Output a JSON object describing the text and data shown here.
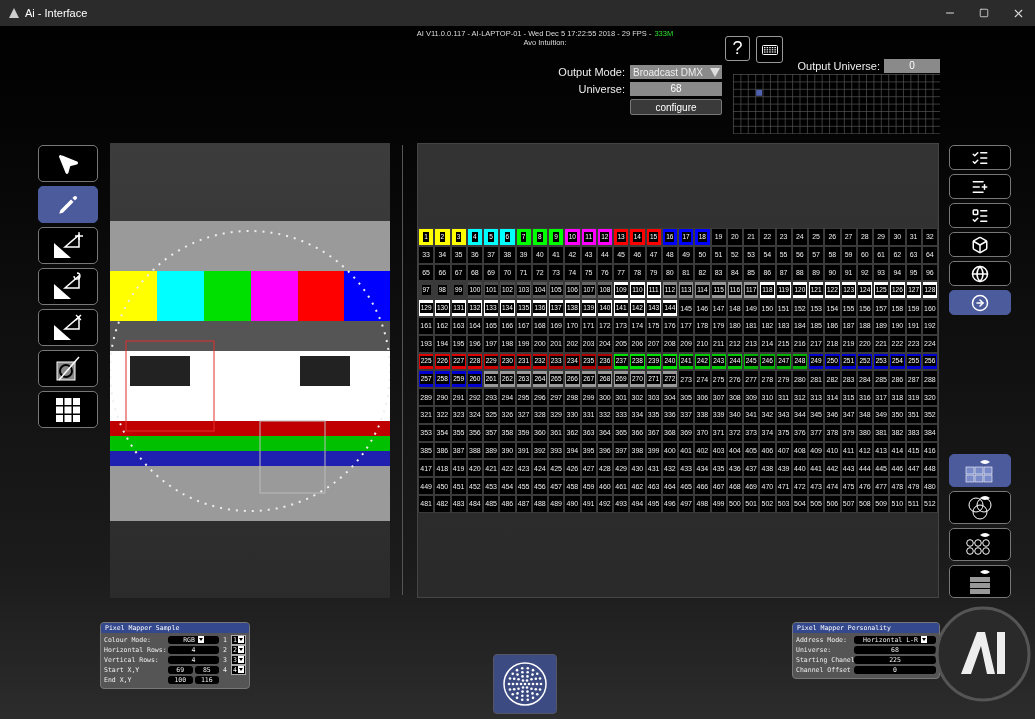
{
  "window": {
    "title": "Ai - Interface"
  },
  "info": {
    "text": "AI V11.0.0.117 - AI-LAPTOP-01 - Wed Dec 5 17:22:55 2018 - 29 FPS -",
    "memory": "333M",
    "subtitle": "Avo Intuition:"
  },
  "help_button": {
    "label": "?"
  },
  "output": {
    "mode_label": "Output Mode:",
    "mode_value": "Broadcast DMX",
    "universe_label": "Universe:",
    "universe_value": "68",
    "configure": "configure",
    "output_universe_label": "Output Universe:",
    "output_universe_value": "0"
  },
  "left_tools": [
    {
      "selected": false
    },
    {
      "selected": true
    },
    {
      "selected": false
    },
    {
      "selected": false
    },
    {
      "selected": false
    },
    {
      "selected": false
    },
    {
      "selected": false
    }
  ],
  "right_tools": [
    {
      "selected": false
    },
    {
      "selected": false
    },
    {
      "selected": false
    },
    {
      "selected": false
    },
    {
      "selected": false
    },
    {
      "selected": true
    }
  ],
  "view_tools": [
    {
      "selected": true
    },
    {
      "selected": false
    },
    {
      "selected": false
    },
    {
      "selected": false
    }
  ],
  "grid": {
    "rows": [
      {
        "cells": [
          {
            "label": "1",
            "color": "#ffff00"
          },
          {
            "label": "2",
            "color": "#ffff00"
          },
          {
            "label": "3",
            "color": "#ffff00"
          },
          {
            "label": "4",
            "color": "#00ffff"
          },
          {
            "label": "5",
            "color": "#00ffff"
          },
          {
            "label": "6",
            "color": "#00ffff"
          },
          {
            "label": "7",
            "color": "#00ff00"
          },
          {
            "label": "8",
            "color": "#00ff00"
          },
          {
            "label": "9",
            "color": "#00ff00"
          },
          {
            "label": "10",
            "color": "#ff00ff"
          },
          {
            "label": "11",
            "color": "#ff00ff"
          },
          {
            "label": "12",
            "color": "#ff00ff"
          },
          {
            "label": "13",
            "color": "#ff0000"
          },
          {
            "label": "14",
            "color": "#ff0000"
          },
          {
            "label": "15",
            "color": "#ff0000"
          },
          {
            "label": "16",
            "color": "#0000ff"
          },
          {
            "label": "17",
            "color": "#0000ff"
          },
          {
            "label": "18",
            "color": "#0000ff"
          },
          "19",
          "20",
          "21",
          "22",
          "23",
          "24",
          "25",
          "26",
          "27",
          "28",
          "29",
          "30",
          "31",
          "32"
        ]
      },
      {
        "cells": [
          "33",
          "34",
          "35",
          "36",
          "37",
          "38",
          "39",
          "40",
          "41",
          "42",
          "43",
          "44",
          "45",
          "46",
          "47",
          "48",
          "49",
          "50",
          "51",
          "52",
          "53",
          "54",
          "55",
          "56",
          "57",
          "58",
          "59",
          "60",
          "61",
          "62",
          "63",
          "64"
        ]
      },
      {
        "cells": [
          "65",
          "66",
          "67",
          "68",
          "69",
          "70",
          "71",
          "72",
          "73",
          "74",
          "75",
          "76",
          "77",
          "78",
          "79",
          "80",
          "81",
          "82",
          "83",
          "84",
          "85",
          "86",
          "87",
          "88",
          "89",
          "90",
          "91",
          "92",
          "93",
          "94",
          "95",
          "96"
        ]
      },
      {
        "cells": [
          {
            "label": "97",
            "color": "#3a3a3a"
          },
          {
            "label": "98",
            "color": "#3a3a3a"
          },
          {
            "label": "99",
            "color": "#3a3a3a"
          },
          {
            "label": "100",
            "color": "#4a4a4a"
          },
          {
            "label": "101",
            "color": "#4a4a4a"
          },
          {
            "label": "102",
            "color": "#4a4a4a"
          },
          {
            "label": "103",
            "color": "#565656"
          },
          {
            "label": "104",
            "color": "#565656"
          },
          {
            "label": "105",
            "color": "#565656"
          },
          {
            "label": "106",
            "color": "#666666"
          },
          {
            "label": "107",
            "color": "#666666"
          },
          {
            "label": "108",
            "color": "#666666"
          },
          {
            "label": "109",
            "color": "#ffffff"
          },
          {
            "label": "110",
            "color": "#ffffff"
          },
          {
            "label": "111",
            "color": "#ffffff"
          },
          {
            "label": "112",
            "color": "#888888"
          },
          {
            "label": "113",
            "color": "#888888"
          },
          {
            "label": "114",
            "color": "#888888"
          },
          {
            "label": "115",
            "color": "#999999"
          },
          {
            "label": "116",
            "color": "#999999"
          },
          {
            "label": "117",
            "color": "#999999"
          },
          {
            "label": "118",
            "color": "#ffffff"
          },
          {
            "label": "119",
            "color": "#ffffff"
          },
          {
            "label": "120",
            "color": "#ffffff"
          },
          {
            "label": "121",
            "color": "#ffffff"
          },
          {
            "label": "122",
            "color": "#ffffff"
          },
          {
            "label": "123",
            "color": "#ffffff"
          },
          {
            "label": "124",
            "color": "#ffffff"
          },
          {
            "label": "125",
            "color": "#ffffff"
          },
          {
            "label": "126",
            "color": "#ffffff"
          },
          {
            "label": "127",
            "color": "#ffffff"
          },
          {
            "label": "128",
            "color": "#ffffff"
          }
        ]
      },
      {
        "cells": [
          {
            "label": "129",
            "color": "#ffffff"
          },
          {
            "label": "130",
            "color": "#ffffff"
          },
          {
            "label": "131",
            "color": "#ffffff"
          },
          {
            "label": "132",
            "color": "#ffffff"
          },
          {
            "label": "133",
            "color": "#ffffff"
          },
          {
            "label": "134",
            "color": "#ffffff"
          },
          {
            "label": "135",
            "color": "#ffffff"
          },
          {
            "label": "136",
            "color": "#ffffff"
          },
          {
            "label": "137",
            "color": "#ffffff"
          },
          {
            "label": "138",
            "color": "#ffffff"
          },
          {
            "label": "139",
            "color": "#ffffff"
          },
          {
            "label": "140",
            "color": "#ffffff"
          },
          {
            "label": "141",
            "color": "#ffffff"
          },
          {
            "label": "142",
            "color": "#ffffff"
          },
          {
            "label": "143",
            "color": "#ffffff"
          },
          {
            "label": "144",
            "color": "#ffffff"
          },
          "145",
          "146",
          "147",
          "148",
          "149",
          "150",
          "151",
          "152",
          "153",
          "154",
          "155",
          "156",
          "157",
          "158",
          "159",
          "160"
        ]
      },
      {
        "cells": [
          "161",
          "162",
          "163",
          "164",
          "165",
          "166",
          "167",
          "168",
          "169",
          "170",
          "171",
          "172",
          "173",
          "174",
          "175",
          "176",
          "177",
          "178",
          "179",
          "180",
          "181",
          "182",
          "183",
          "184",
          "185",
          "186",
          "187",
          "188",
          "189",
          "190",
          "191",
          "192"
        ]
      },
      {
        "cells": [
          "193",
          "194",
          "195",
          "196",
          "197",
          "198",
          "199",
          "200",
          "201",
          "202",
          "203",
          "204",
          "205",
          "206",
          "207",
          "208",
          "209",
          "210",
          "211",
          "212",
          "213",
          "214",
          "215",
          "216",
          "217",
          "218",
          "219",
          "220",
          "221",
          "222",
          "223",
          "224"
        ]
      },
      {
        "cells": [
          {
            "label": "225",
            "color": "#e00000"
          },
          {
            "label": "226",
            "color": "#e00000"
          },
          {
            "label": "227",
            "color": "#e00000"
          },
          {
            "label": "228",
            "color": "#e00000"
          },
          {
            "label": "229",
            "color": "#c80000"
          },
          {
            "label": "230",
            "color": "#c80000"
          },
          {
            "label": "231",
            "color": "#c80000"
          },
          {
            "label": "232",
            "color": "#c80000"
          },
          {
            "label": "233",
            "color": "#b00000"
          },
          {
            "label": "234",
            "color": "#b00000"
          },
          {
            "label": "235",
            "color": "#b00000"
          },
          {
            "label": "236",
            "color": "#b00000"
          },
          {
            "label": "237",
            "color": "#00e000"
          },
          {
            "label": "238",
            "color": "#00e000"
          },
          {
            "label": "239",
            "color": "#00e000"
          },
          {
            "label": "240",
            "color": "#00e000"
          },
          {
            "label": "241",
            "color": "#00c800"
          },
          {
            "label": "242",
            "color": "#00c800"
          },
          {
            "label": "243",
            "color": "#00c800"
          },
          {
            "label": "244",
            "color": "#00c800"
          },
          {
            "label": "245",
            "color": "#00b000"
          },
          {
            "label": "246",
            "color": "#00b000"
          },
          {
            "label": "247",
            "color": "#00b000"
          },
          {
            "label": "248",
            "color": "#00b000"
          },
          {
            "label": "249",
            "color": "#0000d0"
          },
          {
            "label": "250",
            "color": "#0000d0"
          },
          {
            "label": "251",
            "color": "#0000d0"
          },
          {
            "label": "252",
            "color": "#0000d0"
          },
          {
            "label": "253",
            "color": "#0000d0"
          },
          {
            "label": "254",
            "color": "#0000d0"
          },
          {
            "label": "255",
            "color": "#0000d0"
          },
          {
            "label": "256",
            "color": "#0000d0"
          }
        ]
      },
      {
        "cells": [
          {
            "label": "257",
            "color": "#0000d0"
          },
          {
            "label": "258",
            "color": "#0000d0"
          },
          {
            "label": "259",
            "color": "#0000d0"
          },
          {
            "label": "260",
            "color": "#0000d0"
          },
          {
            "label": "261",
            "color": "#999999"
          },
          {
            "label": "262",
            "color": "#999999"
          },
          {
            "label": "263",
            "color": "#999999"
          },
          {
            "label": "264",
            "color": "#999999"
          },
          {
            "label": "265",
            "color": "#999999"
          },
          {
            "label": "266",
            "color": "#999999"
          },
          {
            "label": "267",
            "color": "#999999"
          },
          {
            "label": "268",
            "color": "#999999"
          },
          {
            "label": "269",
            "color": "#999999"
          },
          {
            "label": "270",
            "color": "#999999"
          },
          {
            "label": "271",
            "color": "#999999"
          },
          {
            "label": "272",
            "color": "#999999"
          },
          "273",
          "274",
          "275",
          "276",
          "277",
          "278",
          "279",
          "280",
          "281",
          "282",
          "283",
          "284",
          "285",
          "286",
          "287",
          "288"
        ]
      },
      {
        "cells": [
          "289",
          "290",
          "291",
          "292",
          "293",
          "294",
          "295",
          "296",
          "297",
          "298",
          "299",
          "300",
          "301",
          "302",
          "303",
          "304",
          "305",
          "306",
          "307",
          "308",
          "309",
          "310",
          "311",
          "312",
          "313",
          "314",
          "315",
          "316",
          "317",
          "318",
          "319",
          "320"
        ]
      },
      {
        "cells": [
          "321",
          "322",
          "323",
          "324",
          "325",
          "326",
          "327",
          "328",
          "329",
          "330",
          "331",
          "332",
          "333",
          "334",
          "335",
          "336",
          "337",
          "338",
          "339",
          "340",
          "341",
          "342",
          "343",
          "344",
          "345",
          "346",
          "347",
          "348",
          "349",
          "350",
          "351",
          "352"
        ]
      },
      {
        "cells": [
          "353",
          "354",
          "355",
          "356",
          "357",
          "358",
          "359",
          "360",
          "361",
          "362",
          "363",
          "364",
          "365",
          "366",
          "367",
          "368",
          "369",
          "370",
          "371",
          "372",
          "373",
          "374",
          "375",
          "376",
          "377",
          "378",
          "379",
          "380",
          "381",
          "382",
          "383",
          "384"
        ]
      },
      {
        "cells": [
          "385",
          "386",
          "387",
          "388",
          "389",
          "390",
          "391",
          "392",
          "393",
          "394",
          "395",
          "396",
          "397",
          "398",
          "399",
          "400",
          "401",
          "402",
          "403",
          "404",
          "405",
          "406",
          "407",
          "408",
          "409",
          "410",
          "411",
          "412",
          "413",
          "414",
          "415",
          "416"
        ]
      },
      {
        "cells": [
          "417",
          "418",
          "419",
          "420",
          "421",
          "422",
          "423",
          "424",
          "425",
          "426",
          "427",
          "428",
          "429",
          "430",
          "431",
          "432",
          "433",
          "434",
          "435",
          "436",
          "437",
          "438",
          "439",
          "440",
          "441",
          "442",
          "443",
          "444",
          "445",
          "446",
          "447",
          "448"
        ]
      },
      {
        "cells": [
          "449",
          "450",
          "451",
          "452",
          "453",
          "454",
          "455",
          "456",
          "457",
          "458",
          "459",
          "460",
          "461",
          "462",
          "463",
          "464",
          "465",
          "466",
          "467",
          "468",
          "469",
          "470",
          "471",
          "472",
          "473",
          "474",
          "475",
          "476",
          "477",
          "478",
          "479",
          "480"
        ]
      },
      {
        "cells": [
          "481",
          "482",
          "483",
          "484",
          "485",
          "486",
          "487",
          "488",
          "489",
          "490",
          "491",
          "492",
          "493",
          "494",
          "495",
          "496",
          "497",
          "498",
          "499",
          "500",
          "501",
          "502",
          "503",
          "504",
          "505",
          "506",
          "507",
          "508",
          "509",
          "510",
          "511",
          "512"
        ]
      }
    ]
  },
  "sample_panel": {
    "title": "Pixel Mapper Sample",
    "fields": [
      {
        "label": "Colour Mode:",
        "kind": "select",
        "values": [
          "RGB"
        ]
      },
      {
        "label": "Horizontal Rows:",
        "kind": "number",
        "values": [
          "4"
        ]
      },
      {
        "label": "Vertical Rows:",
        "kind": "number",
        "values": [
          "4"
        ]
      },
      {
        "label": "Start X,Y",
        "kind": "number",
        "values": [
          "69",
          "85"
        ]
      },
      {
        "label": "End X,Y",
        "kind": "number",
        "values": [
          "100",
          "116"
        ]
      }
    ],
    "channels": [
      {
        "index": "1",
        "value": "1"
      },
      {
        "index": "2",
        "value": "2"
      },
      {
        "index": "3",
        "value": "3"
      },
      {
        "index": "4",
        "value": "4"
      }
    ]
  },
  "personality_panel": {
    "title": "Pixel Mapper Personality",
    "fields": [
      {
        "label": "Address Mode:",
        "kind": "select",
        "values": [
          "Horizontal L-R"
        ]
      },
      {
        "label": "Universe:",
        "kind": "number",
        "values": [
          "68"
        ]
      },
      {
        "label": "Starting Chanel",
        "kind": "number",
        "values": [
          "225"
        ]
      },
      {
        "label": "Channel Offset",
        "kind": "number",
        "values": [
          "0"
        ]
      }
    ]
  }
}
